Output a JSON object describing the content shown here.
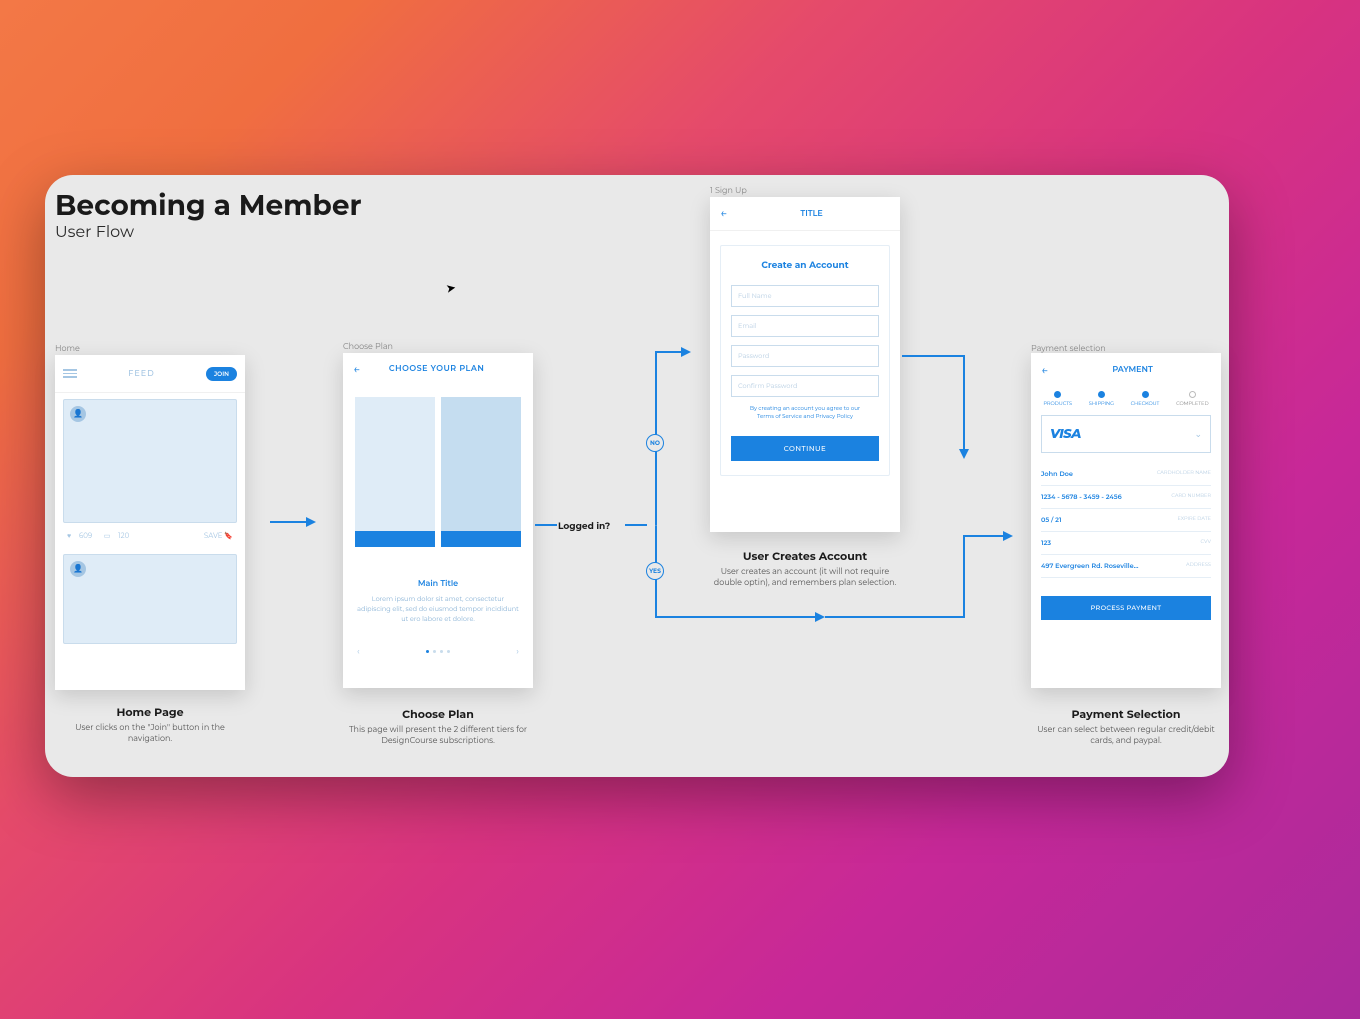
{
  "title": "Becoming a Member",
  "subtitle": "User Flow",
  "decision_label": "Logged in?",
  "badges": {
    "no": "NO",
    "yes": "YES"
  },
  "frames": {
    "home": {
      "label": "Home",
      "header": {
        "feed": "FEED",
        "join": "JOIN"
      },
      "stats": {
        "likes": "609",
        "comments": "120",
        "save": "SAVE"
      },
      "caption_title": "Home Page",
      "caption_body": "User clicks on the \"Join\" button in the navigation."
    },
    "plan": {
      "label": "Choose Plan",
      "header_title": "CHOOSE YOUR PLAN",
      "main_title": "Main Title",
      "lorem": "Lorem ipsum dolor sit amet, consectetur adipiscing elit, sed do eiusmod tempor incididunt ut ero labore et dolore.",
      "caption_title": "Choose Plan",
      "caption_body": "This page will present the 2 different tiers for DesignCourse subscriptions."
    },
    "signup": {
      "label": "1 Sign Up",
      "header_title": "TITLE",
      "card_title": "Create an Account",
      "fields": {
        "name": "Full Name",
        "email": "Email",
        "password": "Password",
        "confirm": "Confirm Password"
      },
      "terms_prefix": "By creating an account you agree to our",
      "terms_link1": "Terms of Service",
      "terms_mid": " and ",
      "terms_link2": "Privacy Policy",
      "continue": "CONTINUE",
      "caption_title": "User Creates Account",
      "caption_body": "User creates an account (it will not require double optin), and remembers plan selection."
    },
    "payment": {
      "label": "Payment selection",
      "header_title": "PAYMENT",
      "steps": {
        "products": "PRODUCTS",
        "shipping": "SHIPPING",
        "checkout": "CHECKOUT",
        "completed": "COMPLETED"
      },
      "visa": "VISA",
      "fields": {
        "name_val": "John Doe",
        "name_lbl": "CARDHOLDER NAME",
        "num_val": "1234 - 5678 - 3459 - 2456",
        "num_lbl": "CARD NUMBER",
        "exp_val": "05   /   21",
        "exp_lbl": "EXPIRE DATE",
        "cvv_val": "123",
        "cvv_lbl": "CVV",
        "addr_val": "497 Evergreen Rd. Roseville…",
        "addr_lbl": "ADDRESS"
      },
      "process": "PROCESS PAYMENT",
      "caption_title": "Payment Selection",
      "caption_body": "User can select between regular credit/debit cards, and paypal."
    }
  }
}
